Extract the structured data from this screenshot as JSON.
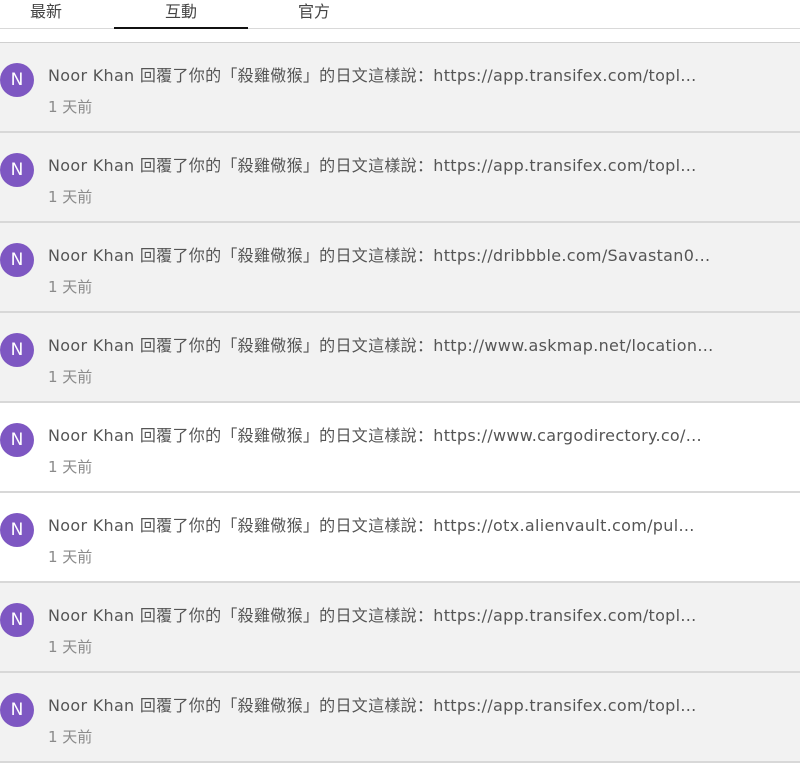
{
  "tabs": [
    {
      "label": "最新",
      "active": false
    },
    {
      "label": "互動",
      "active": true
    },
    {
      "label": "官方",
      "active": false
    }
  ],
  "colors": {
    "avatar": "#7e57c2",
    "tab_underline": "#111111"
  },
  "notifications": [
    {
      "avatar": "N",
      "text": "Noor Khan 回覆了你的「殺雞儆猴」的日文這樣說：https://app.transifex.com/topl...",
      "time": "1 天前",
      "background": "gray"
    },
    {
      "avatar": "N",
      "text": "Noor Khan 回覆了你的「殺雞儆猴」的日文這樣說：https://app.transifex.com/topl...",
      "time": "1 天前",
      "background": "gray"
    },
    {
      "avatar": "N",
      "text": "Noor Khan 回覆了你的「殺雞儆猴」的日文這樣說：https://dribbble.com/Savastan0...",
      "time": "1 天前",
      "background": "gray"
    },
    {
      "avatar": "N",
      "text": "Noor Khan 回覆了你的「殺雞儆猴」的日文這樣說：http://www.askmap.net/location...",
      "time": "1 天前",
      "background": "gray"
    },
    {
      "avatar": "N",
      "text": "Noor Khan 回覆了你的「殺雞儆猴」的日文這樣說：https://www.cargodirectory.co/...",
      "time": "1 天前",
      "background": "white"
    },
    {
      "avatar": "N",
      "text": "Noor Khan 回覆了你的「殺雞儆猴」的日文這樣說：https://otx.alienvault.com/pul...",
      "time": "1 天前",
      "background": "white"
    },
    {
      "avatar": "N",
      "text": "Noor Khan 回覆了你的「殺雞儆猴」的日文這樣說：https://app.transifex.com/topl...",
      "time": "1 天前",
      "background": "gray"
    },
    {
      "avatar": "N",
      "text": "Noor Khan 回覆了你的「殺雞儆猴」的日文這樣說：https://app.transifex.com/topl...",
      "time": "1 天前",
      "background": "gray"
    }
  ]
}
